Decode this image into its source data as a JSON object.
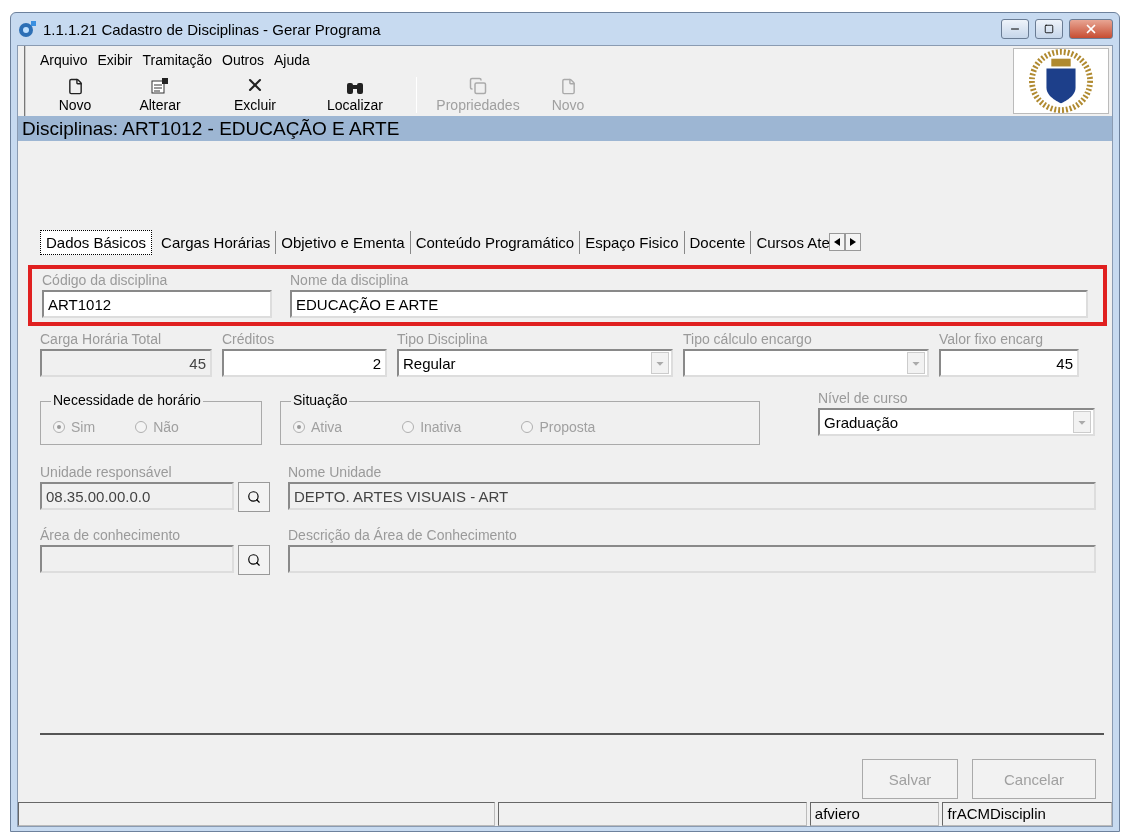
{
  "window": {
    "title": "1.1.1.21 Cadastro de Disciplinas - Gerar Programa"
  },
  "menu": [
    "Arquivo",
    "Exibir",
    "Tramitação",
    "Outros",
    "Ajuda"
  ],
  "toolbar": [
    {
      "label": "Novo",
      "disabled": false
    },
    {
      "label": "Alterar",
      "disabled": false
    },
    {
      "label": "Excluir",
      "disabled": false
    },
    {
      "label": "Localizar",
      "disabled": false
    },
    {
      "label": "Propriedades",
      "disabled": true
    },
    {
      "label": "Novo",
      "disabled": true
    }
  ],
  "header": "Disciplinas: ART1012 - EDUCAÇÃO E ARTE",
  "tabs": [
    {
      "label": "Dados Básicos",
      "selected": true
    },
    {
      "label": "Cargas Horárias",
      "selected": false
    },
    {
      "label": "Objetivo e Ementa",
      "selected": false
    },
    {
      "label": "Conteúdo Programático",
      "selected": false
    },
    {
      "label": "Espaço Fisico",
      "selected": false
    },
    {
      "label": "Docente",
      "selected": false
    },
    {
      "label": "Cursos Ate",
      "selected": false
    }
  ],
  "highlighted_fields": [
    {
      "kind": "text",
      "label": "Código da disciplina",
      "value": "ART1012",
      "readonly": false
    },
    {
      "kind": "text",
      "label": "Nome da disciplina",
      "value": "EDUCAÇÃO E ARTE",
      "readonly": false
    }
  ],
  "fields": [
    {
      "kind": "number",
      "label": "Carga Horária Total",
      "value": "45",
      "readonly": true
    },
    {
      "kind": "number",
      "label": "Créditos",
      "value": "2",
      "readonly": false
    },
    {
      "kind": "select",
      "label": "Tipo Disciplina",
      "value": "Regular",
      "readonly": false
    },
    {
      "kind": "select",
      "label": "Tipo cálculo encargo",
      "readonly": false
    },
    {
      "kind": "number",
      "label": "Valor fixo encarg",
      "value": "45",
      "readonly": false
    }
  ],
  "groups": [
    {
      "title": "Necessidade de horário",
      "options": [
        {
          "label": "Sim",
          "selected": true
        },
        {
          "label": "Não",
          "selected": false
        }
      ]
    },
    {
      "title": "Situação",
      "options": [
        {
          "label": "Ativa",
          "selected": true
        },
        {
          "label": "Inativa",
          "selected": false
        },
        {
          "label": "Proposta",
          "selected": false
        }
      ]
    }
  ],
  "nivel": {
    "kind": "select",
    "label": "Nível de curso",
    "value": "Graduação",
    "readonly": false
  },
  "lookups": [
    {
      "code_label": "Unidade responsável",
      "code": "08.35.00.00.0.0",
      "name_label": "Nome Unidade",
      "name": "DEPTO. ARTES VISUAIS - ART"
    },
    {
      "code_label": "Área de conhecimento",
      "name_label": "Descrição da Área de Conhecimento"
    }
  ],
  "buttons": [
    {
      "label": "Salvar",
      "disabled": true
    },
    {
      "label": "Cancelar",
      "disabled": true
    }
  ],
  "status_bar": [
    "afviero",
    "frACMDisciplin"
  ]
}
